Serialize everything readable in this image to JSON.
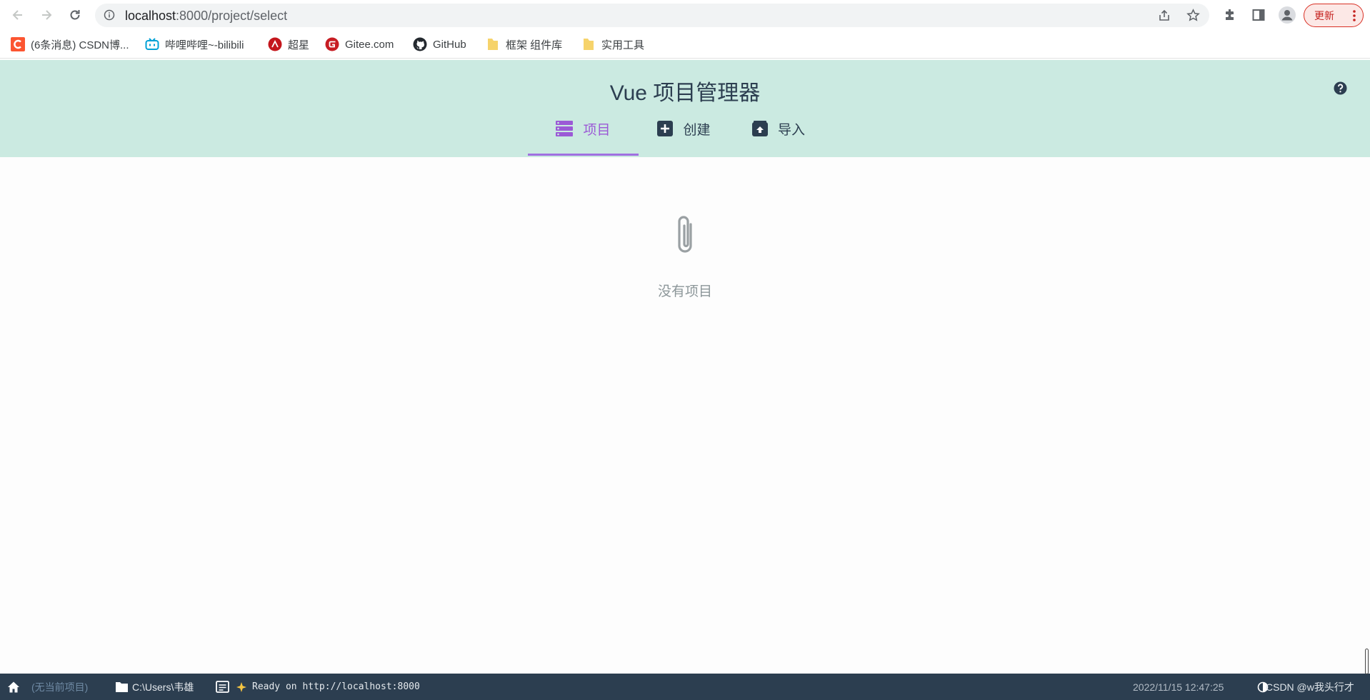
{
  "browser": {
    "url_host": "localhost",
    "url_rest": ":8000/project/select",
    "update_label": "更新"
  },
  "bookmarks": [
    {
      "label": "(6条消息) CSDN博...",
      "icon": "csdn-icon",
      "color": "#fc5531"
    },
    {
      "label": "哔哩哔哩~-bilibili",
      "icon": "bilibili-icon",
      "color": "#00a1d6"
    },
    {
      "label": "超星",
      "icon": "chaoxing-icon",
      "color": "#c4161c"
    },
    {
      "label": "Gitee.com",
      "icon": "gitee-icon",
      "color": "#c71d23"
    },
    {
      "label": "GitHub",
      "icon": "github-icon",
      "color": "#24292f"
    },
    {
      "label": "框架 组件库",
      "icon": "folder-icon",
      "color": "#f6d36b"
    },
    {
      "label": "实用工具",
      "icon": "folder-icon",
      "color": "#f6d36b"
    }
  ],
  "header": {
    "title": "Vue 项目管理器",
    "tabs": [
      {
        "label": "项目",
        "icon": "list-icon",
        "active": true
      },
      {
        "label": "创建",
        "icon": "plus-square-icon",
        "active": false
      },
      {
        "label": "导入",
        "icon": "import-icon",
        "active": false
      }
    ],
    "help_icon": "help-icon"
  },
  "main": {
    "empty_icon": "paperclip-icon",
    "empty_text": "没有项目"
  },
  "status_bar": {
    "current_project": "(无当前项目)",
    "folder": "C:\\Users\\韦雄",
    "log": "Ready on http://localhost:8000",
    "timestamp": "2022/11/15 12:47:25",
    "watermark": "CSDN @w我头行才"
  },
  "colors": {
    "accent": "#9b59d6",
    "header_bg": "#cbeae1",
    "status_bg": "#2c3e50"
  }
}
